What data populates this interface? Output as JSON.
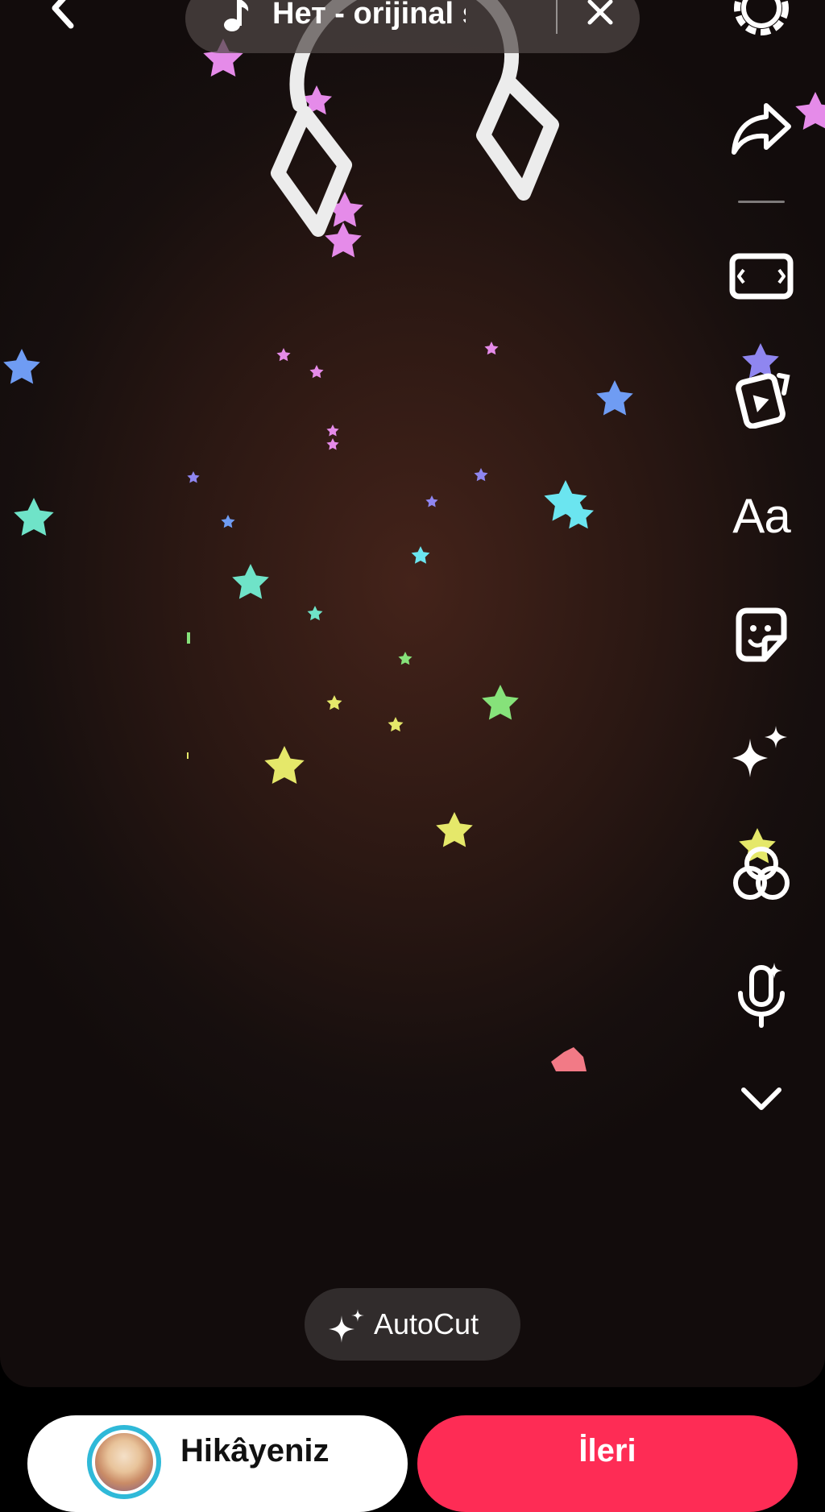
{
  "music": {
    "title": "Нет - orijinal s...",
    "note_icon": "music-note-icon",
    "close_icon": "close-icon"
  },
  "nav": {
    "back_icon": "chevron-left-icon"
  },
  "side_toolbar": {
    "items": [
      {
        "name": "settings",
        "icon": "gear-icon"
      },
      {
        "name": "share",
        "icon": "share-arrow-icon"
      },
      {
        "name": "aspect-ratio",
        "icon": "screen-ratio-icon"
      },
      {
        "name": "templates",
        "icon": "video-cards-icon"
      },
      {
        "name": "text",
        "icon": "text-icon",
        "label": "Aa"
      },
      {
        "name": "stickers",
        "icon": "sticker-icon"
      },
      {
        "name": "effects",
        "icon": "sparkle-icon"
      },
      {
        "name": "filters",
        "icon": "filters-icon"
      },
      {
        "name": "voice-effects",
        "icon": "voice-mic-icon"
      },
      {
        "name": "more",
        "icon": "chevron-down-icon"
      }
    ]
  },
  "autocut": {
    "label": "AutoCut",
    "icon": "sparkle-icon"
  },
  "bottom": {
    "story_label": "Hikâyeniz",
    "next_label": "İleri"
  },
  "colors": {
    "next_button": "#fe2c55",
    "avatar_ring": "#2fb9d8",
    "star_pink": "#e58be9",
    "star_purple": "#8f86f0",
    "star_blue": "#6f9cf3",
    "star_teal": "#6fe3c8",
    "star_cyan": "#6be5f0",
    "star_green": "#86e27a",
    "star_yellow": "#e5e86a",
    "star_red": "#f27a86"
  }
}
